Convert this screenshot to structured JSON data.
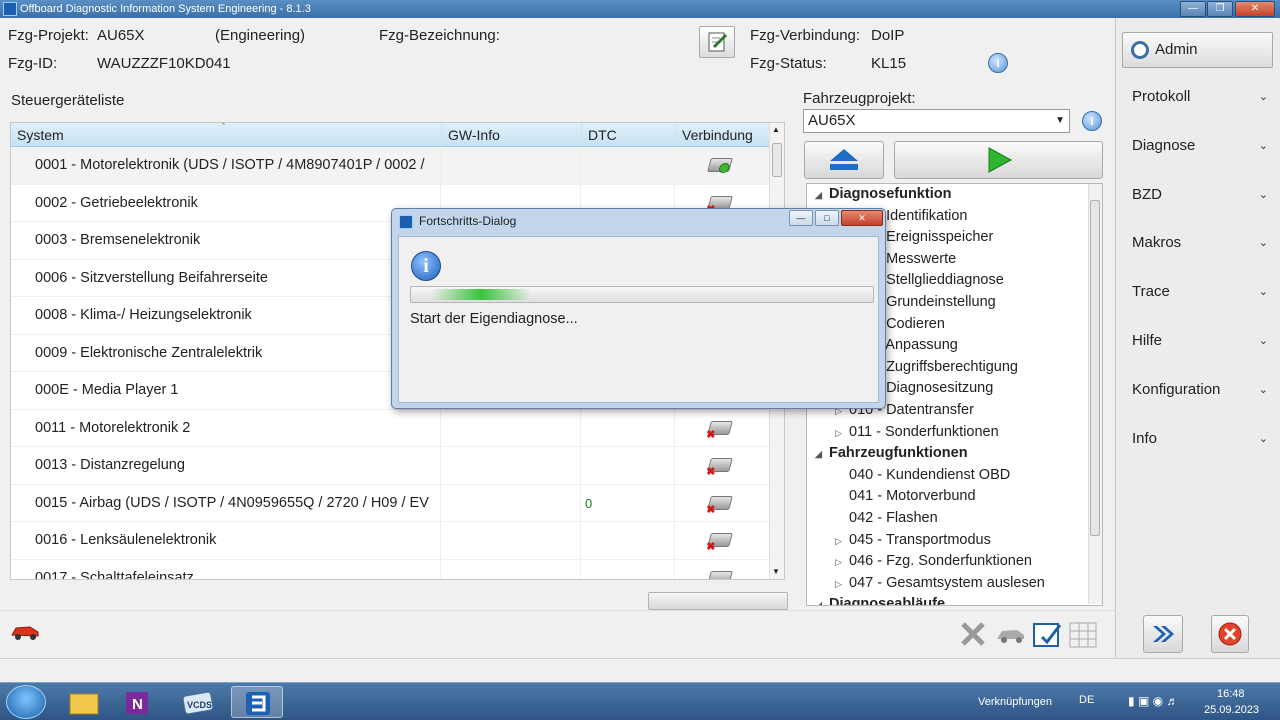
{
  "window": {
    "title": "Offboard Diagnostic Information System Engineering - 8.1.3"
  },
  "header": {
    "projekt_label": "Fzg-Projekt:",
    "projekt_value": "AU65X",
    "projekt_mode": "(Engineering)",
    "bezeichnung_label": "Fzg-Bezeichnung:",
    "bezeichnung_value": "",
    "id_label": "Fzg-ID:",
    "id_value": "WAUZZZF10KD041",
    "verbindung_label": "Fzg-Verbindung:",
    "verbindung_value": "DoIP",
    "status_label": "Fzg-Status:",
    "status_value": "KL15"
  },
  "ecu_list": {
    "title": "Steuergeräteliste",
    "columns": [
      "System",
      "GW-Info",
      "DTC",
      "Verbindung"
    ],
    "rows": [
      {
        "system": "0001 - Motorelektronik  (UDS / ISOTP / 4M8907401P / 0002 /",
        "gw": "",
        "dtc": "",
        "status": "ok"
      },
      {
        "system": "0002 - Getriebeelektronik",
        "gw": "",
        "dtc": "",
        "status": "error"
      },
      {
        "system": "0003 - Bremsenelektronik",
        "gw": "",
        "dtc": "",
        "status": "error"
      },
      {
        "system": "0006 - Sitzverstellung Beifahrerseite",
        "gw": "",
        "dtc": "",
        "status": "error"
      },
      {
        "system": "0008 - Klima-/ Heizungselektronik",
        "gw": "",
        "dtc": "",
        "status": "error"
      },
      {
        "system": "0009 - Elektronische Zentralelektrik",
        "gw": "",
        "dtc": "",
        "status": "error"
      },
      {
        "system": "000E - Media Player 1",
        "gw": "",
        "dtc": "",
        "status": "error"
      },
      {
        "system": "0011 - Motorelektronik 2",
        "gw": "",
        "dtc": "",
        "status": "error"
      },
      {
        "system": "0013 - Distanzregelung",
        "gw": "",
        "dtc": "",
        "status": "error"
      },
      {
        "system": "0015 - Airbag  (UDS / ISOTP / 4N0959655Q / 2720 / H09 / EV",
        "gw": "",
        "dtc": "0",
        "status": "error"
      },
      {
        "system": "0016 - Lenksäulenelektronik",
        "gw": "",
        "dtc": "",
        "status": "error"
      },
      {
        "system": "0017 - Schalttafeleinsatz",
        "gw": "",
        "dtc": "",
        "status": "error"
      }
    ]
  },
  "fahrzeugprojekt": {
    "label": "Fahrzeugprojekt:",
    "selected": "AU65X"
  },
  "tree": {
    "groups": [
      {
        "label": "Diagnosefunktion",
        "items": [
          {
            "label": "001 - Identifikation",
            "expandable": false
          },
          {
            "label": "002 - Ereignisspeicher",
            "expandable": false
          },
          {
            "label": "003 - Messwerte",
            "expandable": false
          },
          {
            "label": "004 - Stellglieddiagnose",
            "expandable": false
          },
          {
            "label": "005 - Grundeinstellung",
            "expandable": false
          },
          {
            "label": "006 - Codieren",
            "expandable": false
          },
          {
            "label": "007 - Anpassung",
            "expandable": false
          },
          {
            "label": "008 - Zugriffsberechtigung",
            "expandable": false
          },
          {
            "label": "009 - Diagnosesitzung",
            "expandable": false
          },
          {
            "label": "010 - Datentransfer",
            "expandable": true
          },
          {
            "label": "011 - Sonderfunktionen",
            "expandable": true
          }
        ]
      },
      {
        "label": "Fahrzeugfunktionen",
        "items": [
          {
            "label": "040 - Kundendienst OBD",
            "expandable": false
          },
          {
            "label": "041 - Motorverbund",
            "expandable": false
          },
          {
            "label": "042 - Flashen",
            "expandable": false
          },
          {
            "label": "045 - Transportmodus",
            "expandable": true
          },
          {
            "label": "046 - Fzg. Sonderfunktionen",
            "expandable": true
          },
          {
            "label": "047 - Gesamtsystem auslesen",
            "expandable": true
          }
        ]
      },
      {
        "label": "Diagnoseabläufe",
        "items": []
      }
    ]
  },
  "sidebar": {
    "admin_label": "Admin",
    "items": [
      "Protokoll",
      "Diagnose",
      "BZD",
      "Makros",
      "Trace",
      "Hilfe",
      "Konfiguration",
      "Info"
    ]
  },
  "dialog": {
    "title": "Fortschritts-Dialog",
    "message": "Start der Eigendiagnose...",
    "progress_note": "indeterminate"
  },
  "taskbar": {
    "link_label": "Verknüpfungen",
    "lang": "DE",
    "time": "16:48",
    "date": "25.09.2023"
  },
  "colors": {
    "accent": "#1c5fb0",
    "ok": "#3cba2c",
    "error": "#d21a1a",
    "selection": "#c6e1f3"
  }
}
